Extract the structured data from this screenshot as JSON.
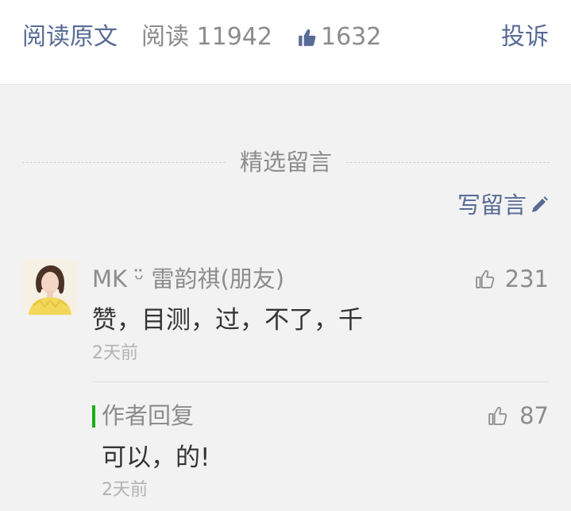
{
  "topbar": {
    "read_original": "阅读原文",
    "read_count": "阅读 11942",
    "like_count": "1632",
    "report": "投诉"
  },
  "selected_comments": {
    "title": "精选留言",
    "write_label": "写留言"
  },
  "comment": {
    "nickname": "MK ᵕ̈ 雷韵祺(朋友)",
    "like_count": "231",
    "text": "赞，目测，过，不了，千",
    "time": "2天前"
  },
  "reply": {
    "label": "作者回复",
    "like_count": "87",
    "text": "可以，的!",
    "time": "2天前"
  },
  "colors": {
    "link": "#576b95",
    "muted": "#8c8c8c",
    "reply_bar": "#1aad19",
    "background": "#f2f2f2"
  }
}
